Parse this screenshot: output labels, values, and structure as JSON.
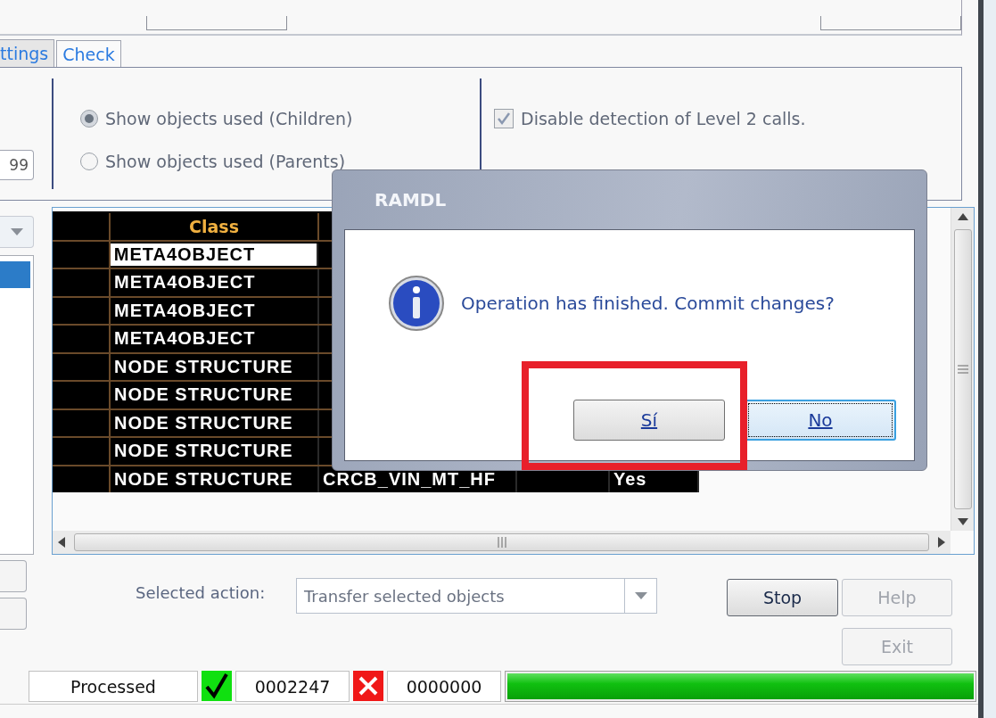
{
  "tabs": [
    {
      "label": "ttings",
      "selected": false
    },
    {
      "label": "Check",
      "selected": true
    }
  ],
  "options": {
    "field_value": "99",
    "radios": [
      {
        "label": "Show objects used (Children)",
        "selected": true,
        "disabled": true
      },
      {
        "label": "Show objects used (Parents)",
        "selected": false,
        "disabled": true
      }
    ],
    "checkbox": {
      "label": "Disable detection of Level 2 calls.",
      "checked": true,
      "disabled": true
    }
  },
  "grid": {
    "columns": [
      "Class"
    ],
    "rows": [
      {
        "class": "META4OBJECT",
        "selected": true
      },
      {
        "class": "META4OBJECT",
        "selected": false
      },
      {
        "class": "META4OBJECT",
        "selected": false
      },
      {
        "class": "META4OBJECT",
        "selected": false
      },
      {
        "class": "NODE STRUCTURE",
        "selected": false
      },
      {
        "class": "NODE STRUCTURE",
        "selected": false
      },
      {
        "class": "NODE STRUCTURE",
        "selected": false
      },
      {
        "class": "NODE STRUCTURE",
        "selected": false
      },
      {
        "class": "NODE STRUCTURE",
        "column_2": "CRCB_VIN_MT_HF",
        "column_4": "Yes",
        "selected": false
      }
    ]
  },
  "action": {
    "label": "Selected action:",
    "value": "Transfer selected objects"
  },
  "buttons": [
    {
      "label": "Stop",
      "disabled": false
    },
    {
      "label": "Help",
      "disabled": true
    },
    {
      "label": "Exit",
      "disabled": true
    }
  ],
  "status_bar": {
    "label": "Processed",
    "ok_count": "0002247",
    "error_count": "0000000",
    "progress": {
      "level": 1
    }
  },
  "dialog": {
    "title": "RAMDL",
    "message": "Operation has finished. Commit changes?",
    "buttons": [
      {
        "label": "Sí",
        "focused": false
      },
      {
        "label": "No",
        "focused": true
      }
    ]
  }
}
